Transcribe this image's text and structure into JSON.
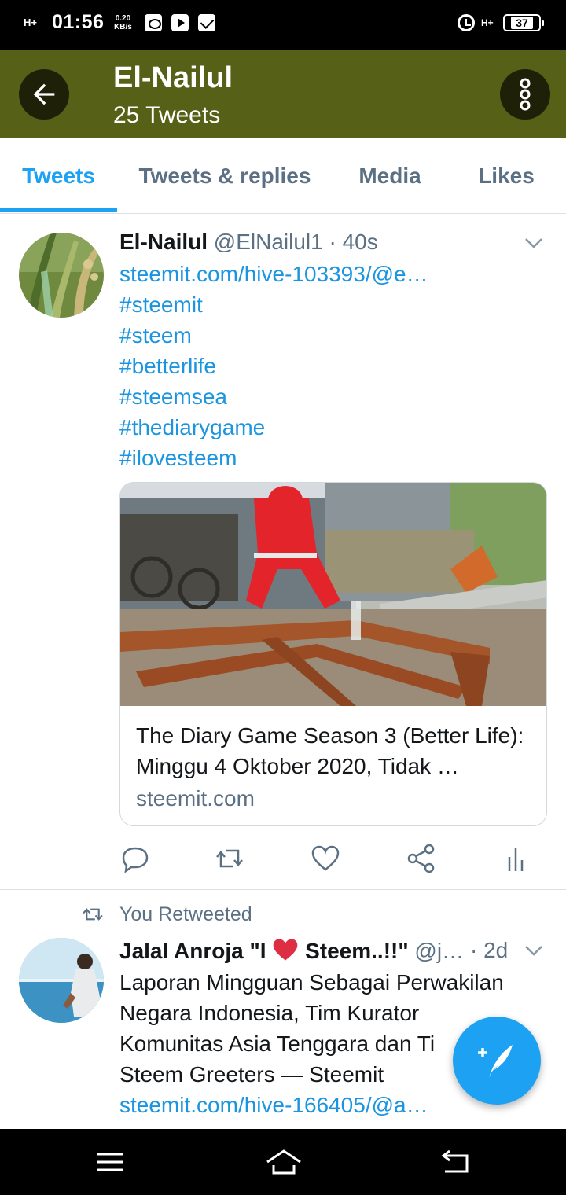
{
  "status_bar": {
    "network": "H+",
    "time": "01:56",
    "speed_value": "0.20",
    "speed_unit": "KB/s",
    "right_network": "H+",
    "battery": "37"
  },
  "header": {
    "title": "El-Nailul",
    "subtitle": "25 Tweets",
    "back_icon": "arrow-left-icon",
    "more_icon": "more-vertical-icon"
  },
  "tabs": [
    {
      "label": "Tweets",
      "active": true
    },
    {
      "label": "Tweets & replies",
      "active": false
    },
    {
      "label": "Media",
      "active": false
    },
    {
      "label": "Likes",
      "active": false
    }
  ],
  "tweet1": {
    "name": "El-Nailul",
    "meta": "@ElNailul1 · 40s",
    "lines": [
      "steemit.com/hive-103393/@e…",
      "#steemit",
      "#steem",
      "#betterlife",
      "#steemsea",
      "#thediarygame",
      "#ilovesteem"
    ],
    "card": {
      "title": "The Diary Game Season 3 (Better Life): Minggu 4 Oktober 2020, Tidak …",
      "domain": "steemit.com"
    },
    "actions": [
      "reply-icon",
      "retweet-icon",
      "like-icon",
      "share-icon",
      "analytics-icon"
    ]
  },
  "tweet2": {
    "retweet_label": "You Retweeted",
    "name_part1": "Jalal Anroja \"I ",
    "name_part2": " Steem..!!\"",
    "handle": "@j…",
    "time": "· 2d",
    "lines": [
      "Laporan Mingguan Sebagai Perwakilan",
      "Negara Indonesia, Tim Kurator",
      "Komunitas Asia Tenggara dan Ti",
      "Steem Greeters — Steemit"
    ],
    "link": "steemit.com/hive-166405/@a…"
  },
  "colors": {
    "accent": "#1da1f2",
    "header_bg": "#566117",
    "link": "#1b95e0"
  }
}
